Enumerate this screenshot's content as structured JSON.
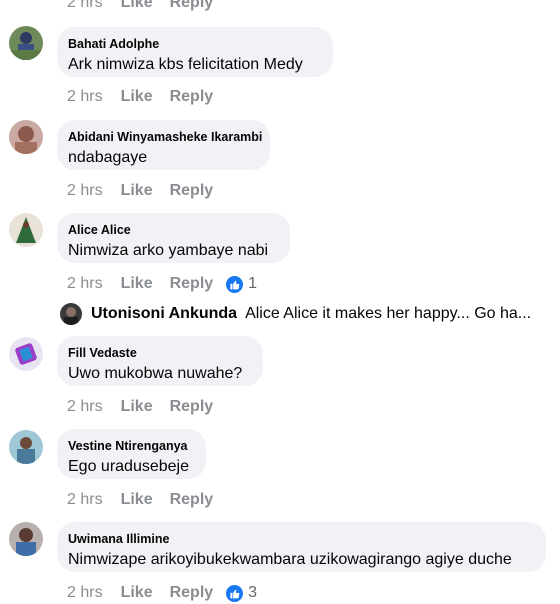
{
  "top_actions": {
    "time": "2 hrs",
    "like": "Like",
    "reply": "Reply"
  },
  "comments": [
    {
      "author": "Bahati Adolphe",
      "text": "Ark nimwiza kbs felicitation Medy",
      "time": "2 hrs",
      "like": "Like",
      "reply": "Reply"
    },
    {
      "author": "Abidani Winyamasheke Ikarambi",
      "text": "ndabagaye",
      "time": "2 hrs",
      "like": "Like",
      "reply": "Reply"
    },
    {
      "author": "Alice Alice",
      "text": "Nimwiza arko yambaye nabi",
      "time": "2 hrs",
      "like": "Like",
      "reply": "Reply",
      "reactions": "1"
    },
    {
      "author": "Fill Vedaste",
      "text": "Uwo mukobwa nuwahe?",
      "time": "2 hrs",
      "like": "Like",
      "reply": "Reply"
    },
    {
      "author": "Vestine Ntirenganya",
      "text": "Ego uradusebeje",
      "time": "2 hrs",
      "like": "Like",
      "reply": "Reply"
    },
    {
      "author": "Uwimana Illimine",
      "text": "Nimwizape arikoyibukekwambara uzikowagirango agiye duche",
      "time": "2 hrs",
      "like": "Like",
      "reply": "Reply",
      "reactions": "3"
    }
  ],
  "reply_preview": {
    "author": "Utonisoni Ankunda",
    "text": "Alice Alice it makes her happy... Go ha..."
  },
  "colors": {
    "bubble": "#f0f2f5",
    "like_blue": "#1877f2",
    "meta_gray": "#8a8d91"
  }
}
